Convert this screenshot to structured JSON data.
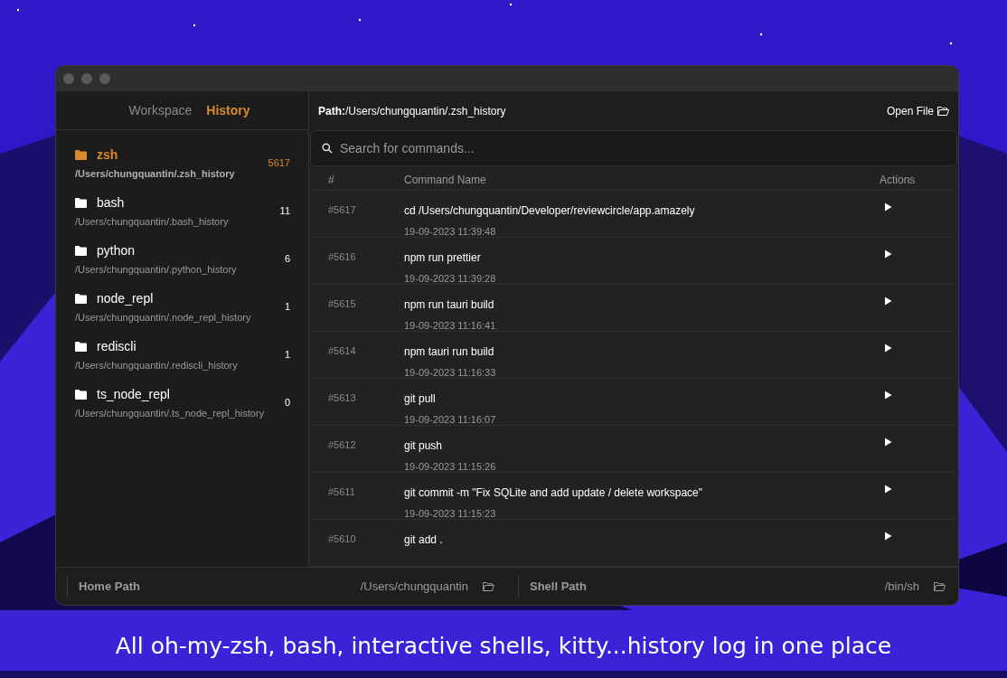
{
  "tabs": [
    {
      "label": "Workspace",
      "selected": false
    },
    {
      "label": "History",
      "selected": true
    }
  ],
  "shells": [
    {
      "name": "zsh",
      "path": "/Users/chungquantin/.zsh_history",
      "count": "5617",
      "selected": true
    },
    {
      "name": "bash",
      "path": "/Users/chungquantin/.bash_history",
      "count": "11",
      "selected": false
    },
    {
      "name": "python",
      "path": "/Users/chungquantin/.python_history",
      "count": "6",
      "selected": false
    },
    {
      "name": "node_repl",
      "path": "/Users/chungquantin/.node_repl_history",
      "count": "1",
      "selected": false
    },
    {
      "name": "rediscli",
      "path": "/Users/chungquantin/.rediscli_history",
      "count": "1",
      "selected": false
    },
    {
      "name": "ts_node_repl",
      "path": "/Users/chungquantin/.ts_node_repl_history",
      "count": "0",
      "selected": false
    }
  ],
  "path_bar": {
    "path": "**Path:**/Users/chungquantin/.zsh_history",
    "open_button": "Open File"
  },
  "search": {
    "placeholder": "Search for commands..."
  },
  "table": {
    "columns": [
      "#",
      "Command Name",
      "Actions"
    ],
    "rows": [
      {
        "id": "#5617",
        "command": "cd /Users/chungquantin/Developer/reviewcircle/app.amazely",
        "time": "19-09-2023 11:39:48"
      },
      {
        "id": "#5616",
        "command": "npm run prettier",
        "time": "19-09-2023 11:39:28"
      },
      {
        "id": "#5615",
        "command": "npm run tauri build",
        "time": "19-09-2023 11:16:41"
      },
      {
        "id": "#5614",
        "command": "npm tauri run build",
        "time": "19-09-2023 11:16:33"
      },
      {
        "id": "#5613",
        "command": "git pull",
        "time": "19-09-2023 11:16:07"
      },
      {
        "id": "#5612",
        "command": "git push",
        "time": "19-09-2023 11:15:26"
      },
      {
        "id": "#5611",
        "command": "git commit -m \"Fix SQLite and add update / delete workspace\"",
        "time": "19-09-2023 11:15:23"
      },
      {
        "id": "#5610",
        "command": "git add ."
      }
    ]
  },
  "footer": [
    {
      "label": "Home Path",
      "value": "/Users/chungquantin"
    },
    {
      "label": "Shell Path",
      "value": "/bin/sh"
    }
  ],
  "caption": "All oh-my-zsh, bash, interactive shells, kitty...history log in one place"
}
